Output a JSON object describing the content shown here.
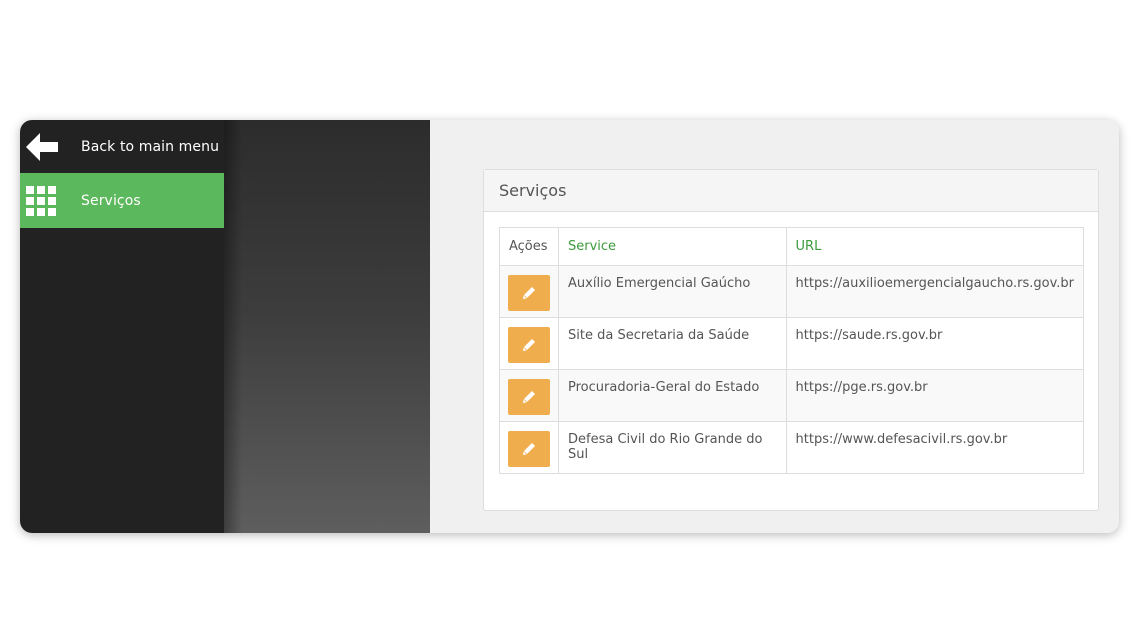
{
  "sidebar": {
    "back": {
      "label": "Back to main menu",
      "icon": "arrow-left-icon"
    },
    "items": [
      {
        "label": "Serviços",
        "icon": "grid-icon",
        "active": true
      }
    ]
  },
  "panel": {
    "title": "Serviços",
    "table": {
      "headers": {
        "actions": "Ações",
        "service": "Service",
        "url": "URL"
      },
      "rows": [
        {
          "service": "Auxílio Emergencial Gaúcho",
          "url": "https://auxilioemergencialgaucho.rs.gov.br"
        },
        {
          "service": "Site da Secretaria da Saúde",
          "url": "https://saude.rs.gov.br"
        },
        {
          "service": "Procuradoria-Geral do Estado",
          "url": "https://pge.rs.gov.br"
        },
        {
          "service": "Defesa Civil do Rio Grande do Sul",
          "url": "https://www.defesacivil.rs.gov.br"
        }
      ]
    }
  },
  "colors": {
    "sidebar_bg": "#222222",
    "active_item": "#5cb85c",
    "edit_button": "#f0ad4e",
    "header_link": "#3c9b3c"
  }
}
